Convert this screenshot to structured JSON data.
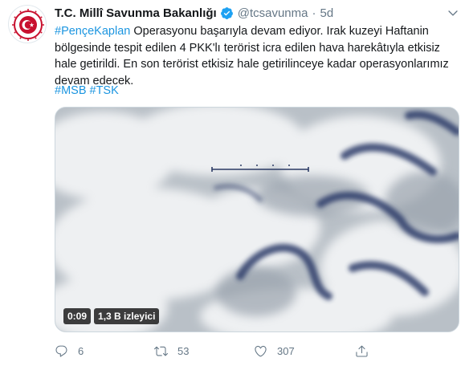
{
  "tweet": {
    "display_name": "T.C. Millî Savunma Bakanlığı",
    "handle": "@tcsavunma",
    "separator": "·",
    "time": "5d",
    "verified": true,
    "hashtag_lead": "#PençeKaplan",
    "body": " Operasyonu başarıyla devam ediyor. Irak kuzeyi Haftanin bölgesinde tespit edilen 4 PKK'lı terörist icra edilen hava harekâtıyla etkisiz hale getirildi. En son terörist etkisiz hale getirilinceye kadar operasyonlarımız devam edecek.",
    "hashtags": [
      "#MSB",
      "#TSK"
    ]
  },
  "media": {
    "type": "video",
    "duration": "0:09",
    "views": "1,3 B izleyici"
  },
  "actions": {
    "reply_count": "6",
    "retweet_count": "53",
    "like_count": "307"
  },
  "icons": [
    "avatar-seal",
    "verified-badge-icon",
    "caret-down-icon",
    "reply-icon",
    "retweet-icon",
    "like-icon",
    "share-icon"
  ],
  "colors": {
    "link": "#1b95e0",
    "secondary": "#657786",
    "avatar_red": "#c8102e"
  }
}
